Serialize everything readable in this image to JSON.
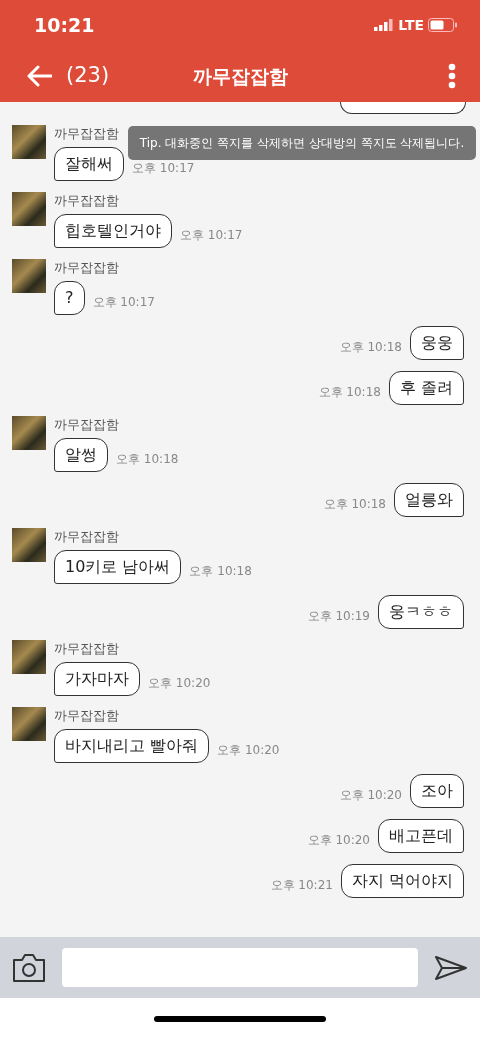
{
  "status_bar": {
    "time": "10:21",
    "network": "LTE"
  },
  "header": {
    "unread_count": "(23)",
    "title": "까무잡잡함"
  },
  "tip": "Tip. 대화중인 쪽지를 삭제하면 상대방의 쪽지도 삭제됩니다.",
  "messages": [
    {
      "kind": "incoming",
      "sender": "까무잡잡함",
      "text": "잘해써",
      "time": "오후 10:17"
    },
    {
      "kind": "incoming",
      "sender": "까무잡잡함",
      "text": "힙호텔인거야",
      "time": "오후 10:17"
    },
    {
      "kind": "incoming",
      "sender": "까무잡잡함",
      "text": "?",
      "time": "오후 10:17"
    },
    {
      "kind": "outgoing",
      "text": "웅웅",
      "time": "오후 10:18"
    },
    {
      "kind": "outgoing",
      "text": "후 졸려",
      "time": "오후 10:18"
    },
    {
      "kind": "incoming",
      "sender": "까무잡잡함",
      "text": "알썽",
      "time": "오후 10:18"
    },
    {
      "kind": "outgoing",
      "text": "얼릉와",
      "time": "오후 10:18"
    },
    {
      "kind": "incoming",
      "sender": "까무잡잡함",
      "text": "10키로 남아써",
      "time": "오후 10:18"
    },
    {
      "kind": "outgoing",
      "text": "웅ㅋㅎㅎ",
      "time": "오후 10:19"
    },
    {
      "kind": "incoming",
      "sender": "까무잡잡함",
      "text": "가자마자",
      "time": "오후 10:20"
    },
    {
      "kind": "incoming",
      "sender": "까무잡잡함",
      "text": "바지내리고 빨아줘",
      "time": "오후 10:20"
    },
    {
      "kind": "outgoing",
      "text": "조아",
      "time": "오후 10:20"
    },
    {
      "kind": "outgoing",
      "text": "배고픈데",
      "time": "오후 10:20"
    },
    {
      "kind": "outgoing",
      "text": "자지 먹어야지",
      "time": "오후 10:21"
    }
  ]
}
